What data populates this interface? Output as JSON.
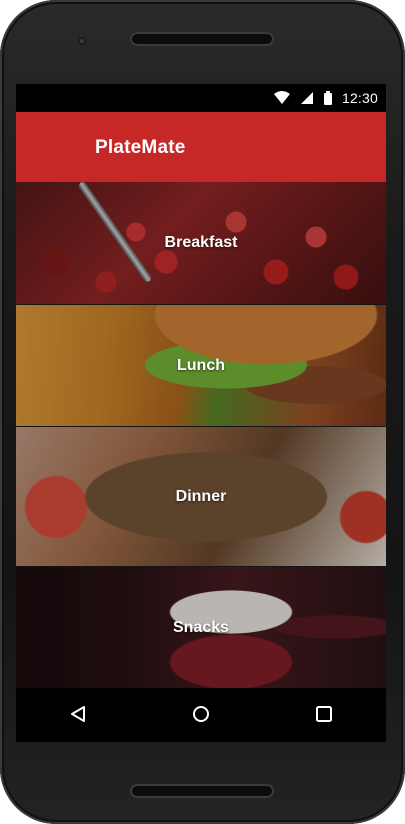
{
  "status_bar": {
    "time": "12:30",
    "icons": [
      "wifi-icon",
      "cell-signal-icon",
      "battery-icon"
    ]
  },
  "app_bar": {
    "title": "PlateMate",
    "color": "#c62828"
  },
  "categories": [
    {
      "label": "Breakfast"
    },
    {
      "label": "Lunch"
    },
    {
      "label": "Dinner"
    },
    {
      "label": "Snacks"
    }
  ],
  "nav_bar": {
    "buttons": [
      "back-icon",
      "home-icon",
      "recents-icon"
    ]
  }
}
